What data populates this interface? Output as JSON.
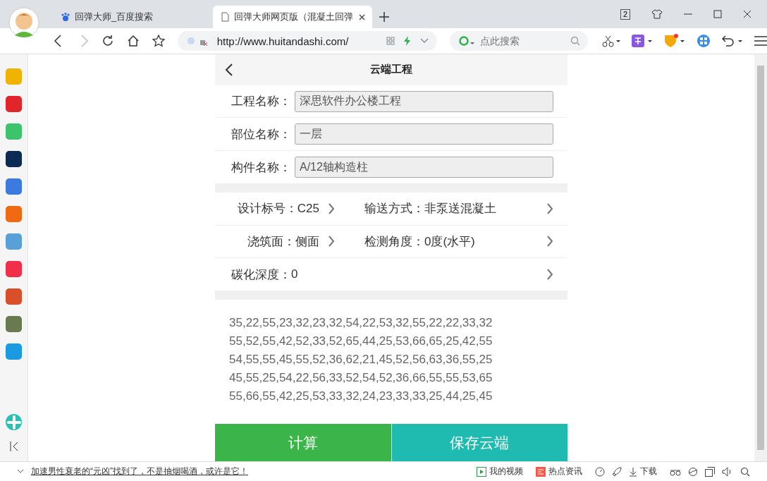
{
  "browser": {
    "tabs": [
      {
        "label": "回弹大师_百度搜索",
        "selected": false
      },
      {
        "label": "回弹大师网页版（混凝土回弹",
        "selected": true
      }
    ],
    "tab_count": "2",
    "address": "http://www.huitandashi.com/",
    "search": {
      "placeholder": "点此搜索"
    }
  },
  "page": {
    "title": "云端工程",
    "fields": [
      {
        "label": "工程名称：",
        "value": "深思软件办公楼工程"
      },
      {
        "label": "部位名称：",
        "value": "一层"
      },
      {
        "label": "构件名称：",
        "value": "A/12轴构造柱"
      }
    ],
    "options": [
      [
        {
          "label": "设计标号：",
          "value": "C25"
        },
        {
          "label": "输送方式：",
          "value": "非泵送混凝土"
        }
      ],
      [
        {
          "label": "浇筑面：",
          "value": "侧面"
        },
        {
          "label": "检测角度：",
          "value": "0度(水平)"
        }
      ],
      [
        {
          "label": "碳化深度：",
          "value": "0"
        }
      ]
    ],
    "readings": [
      "35,22,55,23,32,23,32,54,22,53,32,55,22,22,33,32",
      "55,52,55,42,52,33,52,65,44,25,53,66,65,25,42,55",
      "54,55,55,45,55,52,36,62,21,45,52,56,63,36,55,25",
      "45,55,25,54,22,56,33,52,54,52,36,66,55,55,53,65",
      "55,66,55,42,25,53,33,32,24,23,33,33,25,44,25,45"
    ],
    "buttons": [
      {
        "label": "计算",
        "kind": "calculate"
      },
      {
        "label": "保存云端",
        "kind": "save"
      }
    ]
  },
  "status_bar": {
    "news": "加速男性衰老的“元凶”找到了，不是抽烟喝酒，或许是它！",
    "video": "我的视频",
    "hot": "热点资讯",
    "download": "下载"
  }
}
